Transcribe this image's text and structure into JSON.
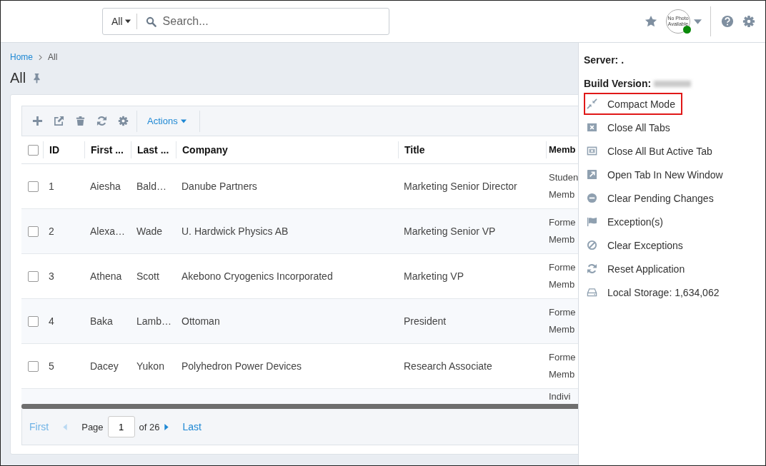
{
  "search": {
    "scope": "All",
    "placeholder": "Search..."
  },
  "avatar": {
    "text": "No Photo Available",
    "online": true
  },
  "breadcrumb": [
    "Home",
    "All"
  ],
  "page_title": "All",
  "toolbar": {
    "actions": "Actions"
  },
  "table": {
    "select_all_checked": false,
    "columns": [
      "ID",
      "First ...",
      "Last ...",
      "Company",
      "Title",
      "Memb"
    ],
    "rows": [
      {
        "checked": false,
        "id": "1",
        "first": "Aiesha",
        "last": "Bald…",
        "company": "Danube Partners",
        "title": "Marketing Senior Director",
        "member": "Studen Memb"
      },
      {
        "checked": false,
        "id": "2",
        "first": "Alexa…",
        "last": "Wade",
        "company": "U. Hardwick Physics AB",
        "title": "Marketing Senior VP",
        "member": "Forme Memb"
      },
      {
        "checked": false,
        "id": "3",
        "first": "Athena",
        "last": "Scott",
        "company": "Akebono Cryogenics Incorporated",
        "title": "Marketing VP",
        "member": "Forme Memb"
      },
      {
        "checked": false,
        "id": "4",
        "first": "Baka",
        "last": "Lamb…",
        "company": "Ottoman",
        "title": "President",
        "member": "Forme Memb"
      },
      {
        "checked": false,
        "id": "5",
        "first": "Dacey",
        "last": "Yukon",
        "company": "Polyhedron Power Devices",
        "title": "Research Associate",
        "member": "Forme Memb"
      },
      {
        "member": "Indivi"
      }
    ]
  },
  "pager": {
    "first": "First",
    "page_label": "Page",
    "page": "1",
    "of": "of 26",
    "last": "Last"
  },
  "panel": {
    "server": "Server: .",
    "build": "Build Version:",
    "items": [
      {
        "kind": "compact",
        "label": "Compact Mode",
        "highlighted": true
      },
      {
        "kind": "close-all",
        "label": "Close All Tabs",
        "highlighted": false
      },
      {
        "kind": "close-but",
        "label": "Close All But Active Tab",
        "highlighted": false
      },
      {
        "kind": "open-window",
        "label": "Open Tab In New Window",
        "highlighted": false
      },
      {
        "kind": "clear-pending",
        "label": "Clear Pending Changes",
        "highlighted": false
      },
      {
        "kind": "flag",
        "label": "Exception(s)",
        "highlighted": false
      },
      {
        "kind": "clear-exc",
        "label": "Clear Exceptions",
        "highlighted": false
      },
      {
        "kind": "reset",
        "label": "Reset Application",
        "highlighted": false
      },
      {
        "kind": "storage",
        "label": "Local Storage: 1,634,062",
        "highlighted": false
      }
    ]
  }
}
